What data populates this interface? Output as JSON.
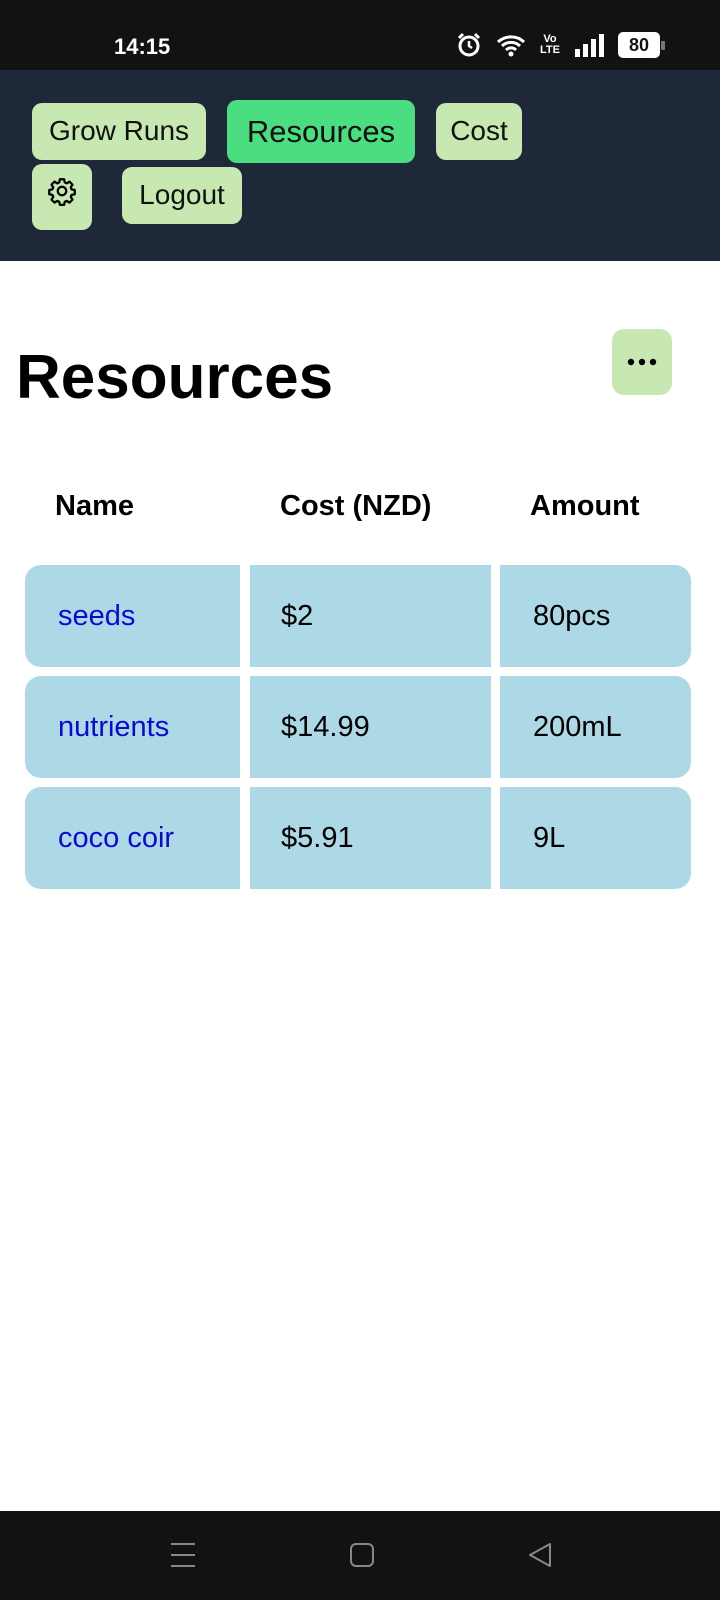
{
  "status": {
    "time": "14:15",
    "battery": "80",
    "network": "VoLTE",
    "icons": [
      "alarm-icon",
      "wifi-icon",
      "volte-icon",
      "signal-icon",
      "battery-icon"
    ]
  },
  "nav": {
    "grow_runs": "Grow Runs",
    "resources": "Resources",
    "cost": "Cost",
    "settings_icon": "gear-icon",
    "logout": "Logout",
    "active": "Resources"
  },
  "page": {
    "title": "Resources",
    "more_icon": "ellipsis-icon"
  },
  "table": {
    "headers": [
      "Name",
      "Cost (NZD)",
      "Amount"
    ],
    "rows": [
      {
        "name": "seeds",
        "cost": "$2",
        "amount": "80pcs"
      },
      {
        "name": "nutrients",
        "cost": "$14.99",
        "amount": "200mL"
      },
      {
        "name": "coco coir",
        "cost": "$5.91",
        "amount": "9L"
      }
    ]
  },
  "system_nav": [
    "menu-icon",
    "home-icon",
    "back-icon"
  ],
  "colors": {
    "nav_bg": "#1f2838",
    "nav_button": "#c7e8b0",
    "nav_button_active": "#4ade80",
    "row_bg": "#add8e6",
    "link": "#0b0bd0"
  }
}
